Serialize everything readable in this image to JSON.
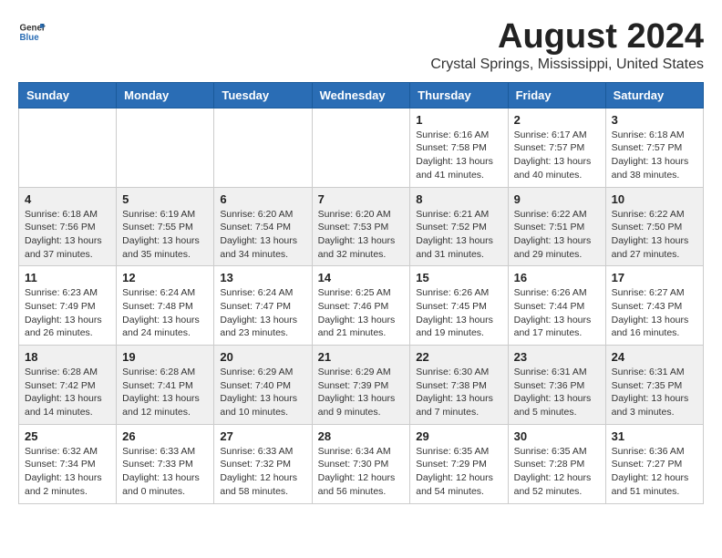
{
  "logo": {
    "text_general": "General",
    "text_blue": "Blue"
  },
  "header": {
    "month_year": "August 2024",
    "location": "Crystal Springs, Mississippi, United States"
  },
  "days_of_week": [
    "Sunday",
    "Monday",
    "Tuesday",
    "Wednesday",
    "Thursday",
    "Friday",
    "Saturday"
  ],
  "weeks": [
    [
      {
        "date": "",
        "sunrise": "",
        "sunset": "",
        "daylight": ""
      },
      {
        "date": "",
        "sunrise": "",
        "sunset": "",
        "daylight": ""
      },
      {
        "date": "",
        "sunrise": "",
        "sunset": "",
        "daylight": ""
      },
      {
        "date": "",
        "sunrise": "",
        "sunset": "",
        "daylight": ""
      },
      {
        "date": "1",
        "sunrise": "Sunrise: 6:16 AM",
        "sunset": "Sunset: 7:58 PM",
        "daylight": "Daylight: 13 hours and 41 minutes."
      },
      {
        "date": "2",
        "sunrise": "Sunrise: 6:17 AM",
        "sunset": "Sunset: 7:57 PM",
        "daylight": "Daylight: 13 hours and 40 minutes."
      },
      {
        "date": "3",
        "sunrise": "Sunrise: 6:18 AM",
        "sunset": "Sunset: 7:57 PM",
        "daylight": "Daylight: 13 hours and 38 minutes."
      }
    ],
    [
      {
        "date": "4",
        "sunrise": "Sunrise: 6:18 AM",
        "sunset": "Sunset: 7:56 PM",
        "daylight": "Daylight: 13 hours and 37 minutes."
      },
      {
        "date": "5",
        "sunrise": "Sunrise: 6:19 AM",
        "sunset": "Sunset: 7:55 PM",
        "daylight": "Daylight: 13 hours and 35 minutes."
      },
      {
        "date": "6",
        "sunrise": "Sunrise: 6:20 AM",
        "sunset": "Sunset: 7:54 PM",
        "daylight": "Daylight: 13 hours and 34 minutes."
      },
      {
        "date": "7",
        "sunrise": "Sunrise: 6:20 AM",
        "sunset": "Sunset: 7:53 PM",
        "daylight": "Daylight: 13 hours and 32 minutes."
      },
      {
        "date": "8",
        "sunrise": "Sunrise: 6:21 AM",
        "sunset": "Sunset: 7:52 PM",
        "daylight": "Daylight: 13 hours and 31 minutes."
      },
      {
        "date": "9",
        "sunrise": "Sunrise: 6:22 AM",
        "sunset": "Sunset: 7:51 PM",
        "daylight": "Daylight: 13 hours and 29 minutes."
      },
      {
        "date": "10",
        "sunrise": "Sunrise: 6:22 AM",
        "sunset": "Sunset: 7:50 PM",
        "daylight": "Daylight: 13 hours and 27 minutes."
      }
    ],
    [
      {
        "date": "11",
        "sunrise": "Sunrise: 6:23 AM",
        "sunset": "Sunset: 7:49 PM",
        "daylight": "Daylight: 13 hours and 26 minutes."
      },
      {
        "date": "12",
        "sunrise": "Sunrise: 6:24 AM",
        "sunset": "Sunset: 7:48 PM",
        "daylight": "Daylight: 13 hours and 24 minutes."
      },
      {
        "date": "13",
        "sunrise": "Sunrise: 6:24 AM",
        "sunset": "Sunset: 7:47 PM",
        "daylight": "Daylight: 13 hours and 23 minutes."
      },
      {
        "date": "14",
        "sunrise": "Sunrise: 6:25 AM",
        "sunset": "Sunset: 7:46 PM",
        "daylight": "Daylight: 13 hours and 21 minutes."
      },
      {
        "date": "15",
        "sunrise": "Sunrise: 6:26 AM",
        "sunset": "Sunset: 7:45 PM",
        "daylight": "Daylight: 13 hours and 19 minutes."
      },
      {
        "date": "16",
        "sunrise": "Sunrise: 6:26 AM",
        "sunset": "Sunset: 7:44 PM",
        "daylight": "Daylight: 13 hours and 17 minutes."
      },
      {
        "date": "17",
        "sunrise": "Sunrise: 6:27 AM",
        "sunset": "Sunset: 7:43 PM",
        "daylight": "Daylight: 13 hours and 16 minutes."
      }
    ],
    [
      {
        "date": "18",
        "sunrise": "Sunrise: 6:28 AM",
        "sunset": "Sunset: 7:42 PM",
        "daylight": "Daylight: 13 hours and 14 minutes."
      },
      {
        "date": "19",
        "sunrise": "Sunrise: 6:28 AM",
        "sunset": "Sunset: 7:41 PM",
        "daylight": "Daylight: 13 hours and 12 minutes."
      },
      {
        "date": "20",
        "sunrise": "Sunrise: 6:29 AM",
        "sunset": "Sunset: 7:40 PM",
        "daylight": "Daylight: 13 hours and 10 minutes."
      },
      {
        "date": "21",
        "sunrise": "Sunrise: 6:29 AM",
        "sunset": "Sunset: 7:39 PM",
        "daylight": "Daylight: 13 hours and 9 minutes."
      },
      {
        "date": "22",
        "sunrise": "Sunrise: 6:30 AM",
        "sunset": "Sunset: 7:38 PM",
        "daylight": "Daylight: 13 hours and 7 minutes."
      },
      {
        "date": "23",
        "sunrise": "Sunrise: 6:31 AM",
        "sunset": "Sunset: 7:36 PM",
        "daylight": "Daylight: 13 hours and 5 minutes."
      },
      {
        "date": "24",
        "sunrise": "Sunrise: 6:31 AM",
        "sunset": "Sunset: 7:35 PM",
        "daylight": "Daylight: 13 hours and 3 minutes."
      }
    ],
    [
      {
        "date": "25",
        "sunrise": "Sunrise: 6:32 AM",
        "sunset": "Sunset: 7:34 PM",
        "daylight": "Daylight: 13 hours and 2 minutes."
      },
      {
        "date": "26",
        "sunrise": "Sunrise: 6:33 AM",
        "sunset": "Sunset: 7:33 PM",
        "daylight": "Daylight: 13 hours and 0 minutes."
      },
      {
        "date": "27",
        "sunrise": "Sunrise: 6:33 AM",
        "sunset": "Sunset: 7:32 PM",
        "daylight": "Daylight: 12 hours and 58 minutes."
      },
      {
        "date": "28",
        "sunrise": "Sunrise: 6:34 AM",
        "sunset": "Sunset: 7:30 PM",
        "daylight": "Daylight: 12 hours and 56 minutes."
      },
      {
        "date": "29",
        "sunrise": "Sunrise: 6:35 AM",
        "sunset": "Sunset: 7:29 PM",
        "daylight": "Daylight: 12 hours and 54 minutes."
      },
      {
        "date": "30",
        "sunrise": "Sunrise: 6:35 AM",
        "sunset": "Sunset: 7:28 PM",
        "daylight": "Daylight: 12 hours and 52 minutes."
      },
      {
        "date": "31",
        "sunrise": "Sunrise: 6:36 AM",
        "sunset": "Sunset: 7:27 PM",
        "daylight": "Daylight: 12 hours and 51 minutes."
      }
    ]
  ]
}
